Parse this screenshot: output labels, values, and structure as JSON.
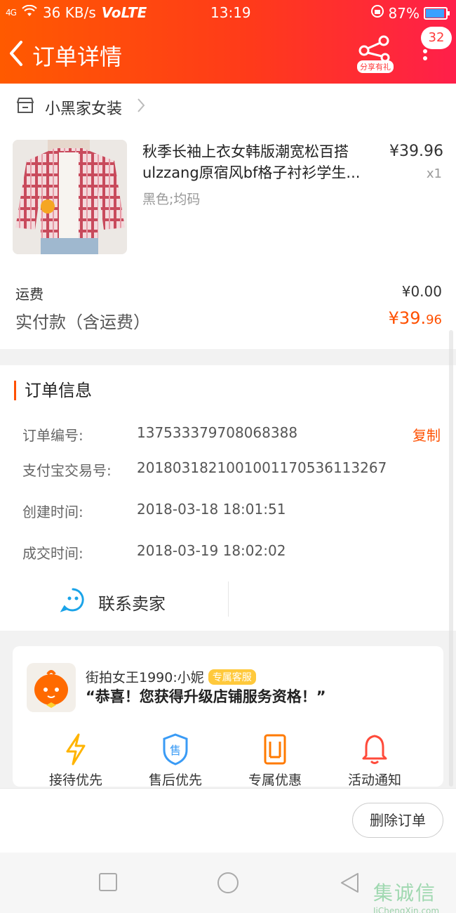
{
  "status_bar": {
    "signal": "4G",
    "speed": "36 KB/s",
    "network": "VoLTE",
    "time": "13:19",
    "battery": "87%"
  },
  "header": {
    "title": "订单详情",
    "share_label": "分享有礼",
    "badge_count": "32"
  },
  "shop": {
    "name": "小黑家女装"
  },
  "product": {
    "name_line1": "秋季长袖上衣女韩版潮宽松百搭",
    "name_line2": "ulzzang原宿风bf格子衬衫学生...",
    "price": "¥39.96",
    "quantity": "x1",
    "sku": "黑色;均码"
  },
  "summary": {
    "shipping_label": "运费",
    "shipping_value": "¥0.00",
    "paid_label": "实付款（含运费）",
    "paid_currency": "¥",
    "paid_int": "39.",
    "paid_cents": "96"
  },
  "order_info": {
    "title": "订单信息",
    "copy_label": "复制",
    "rows": [
      {
        "label": "订单编号:",
        "value": "137533379708068388"
      },
      {
        "label": "支付宝交易号:",
        "value": "2018031821001001170536113267"
      },
      {
        "label": "创建时间:",
        "value": "2018-03-18 18:01:51"
      },
      {
        "label": "成交时间:",
        "value": "2018-03-19 18:02:02"
      }
    ],
    "contact_label": "联系卖家"
  },
  "service": {
    "name": "街拍女王1990:小妮",
    "tag": "专属客服",
    "message": "“恭喜！您获得升级店铺服务资格！”",
    "perks": [
      {
        "label": "接待优先",
        "icon": "lightning-icon",
        "color": "#ffb400"
      },
      {
        "label": "售后优先",
        "icon": "shield-icon",
        "color": "#3a9bf5"
      },
      {
        "label": "专属优惠",
        "icon": "ticket-icon",
        "color": "#ff7a00"
      },
      {
        "label": "活动通知",
        "icon": "bell-icon",
        "color": "#ff4a3a"
      }
    ]
  },
  "actions": {
    "delete_label": "删除订单"
  },
  "watermark": {
    "brand": "集诚信",
    "site": "JiChengXin.com"
  },
  "colors": {
    "accent": "#ff5000",
    "header_start": "#ff5a00",
    "header_end": "#ff1f4a"
  }
}
